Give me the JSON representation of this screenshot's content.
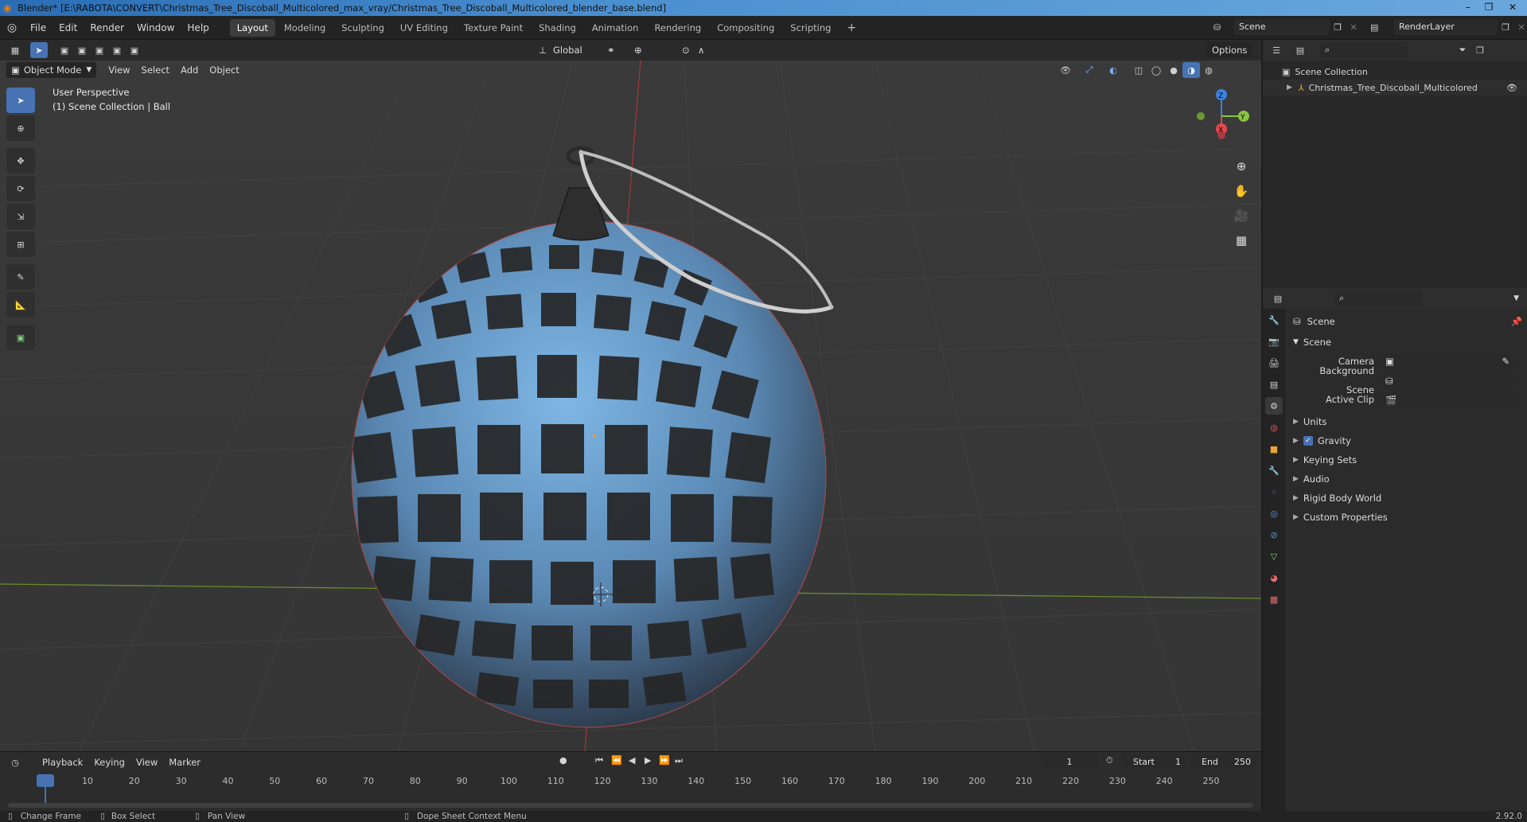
{
  "window": {
    "title": "Blender* [E:\\RABOTA\\CONVERT\\Christmas_Tree_Discoball_Multicolored_max_vray/Christmas_Tree_Discoball_Multicolored_blender_base.blend]",
    "minimize": "–",
    "maximize": "❐",
    "close": "✕"
  },
  "menu": [
    "File",
    "Edit",
    "Render",
    "Window",
    "Help"
  ],
  "workspaces": [
    "Layout",
    "Modeling",
    "Sculpting",
    "UV Editing",
    "Texture Paint",
    "Shading",
    "Animation",
    "Rendering",
    "Compositing",
    "Scripting"
  ],
  "active_workspace": "Layout",
  "add_workspace": "+",
  "scene_field": "Scene",
  "layer_field": "RenderLayer",
  "viewport_header": {
    "orientation": "Global",
    "options": "Options",
    "mode": "Object Mode",
    "menus": [
      "View",
      "Select",
      "Add",
      "Object"
    ]
  },
  "viewport": {
    "perspective": "User Perspective",
    "collection_info": "(1) Scene Collection | Ball",
    "gizmo": {
      "z": "Z",
      "y": "Y",
      "x": "X"
    }
  },
  "outliner": {
    "root": "Scene Collection",
    "items": [
      "Christmas_Tree_Discoball_Multicolored"
    ]
  },
  "properties": {
    "context": "Scene",
    "panel": "Scene",
    "camera_label": "Camera",
    "background_label": "Background Scene",
    "clip_label": "Active Clip",
    "subpanels": [
      "Units",
      "Gravity",
      "Keying Sets",
      "Audio",
      "Rigid Body World",
      "Custom Properties"
    ],
    "gravity_checked": true
  },
  "timeline": {
    "menus": [
      "Playback",
      "Keying",
      "View",
      "Marker"
    ],
    "current_frame": "1",
    "start_label": "Start",
    "start_value": "1",
    "end_label": "End",
    "end_value": "250",
    "ticks": [
      "1",
      "10",
      "20",
      "30",
      "40",
      "50",
      "60",
      "70",
      "80",
      "90",
      "100",
      "110",
      "120",
      "130",
      "140",
      "150",
      "160",
      "170",
      "180",
      "190",
      "200",
      "210",
      "220",
      "230",
      "240",
      "250"
    ]
  },
  "status": {
    "left": "Change Frame",
    "mid": "Box Select",
    "pan": "Pan View",
    "context": "Dope Sheet Context Menu",
    "version": "2.92.0"
  },
  "colors": {
    "accent": "#4772b3",
    "axis_x": "#e8454f",
    "axis_y": "#88c540",
    "axis_z": "#3b83e0",
    "viewport_bg": "#393939"
  }
}
